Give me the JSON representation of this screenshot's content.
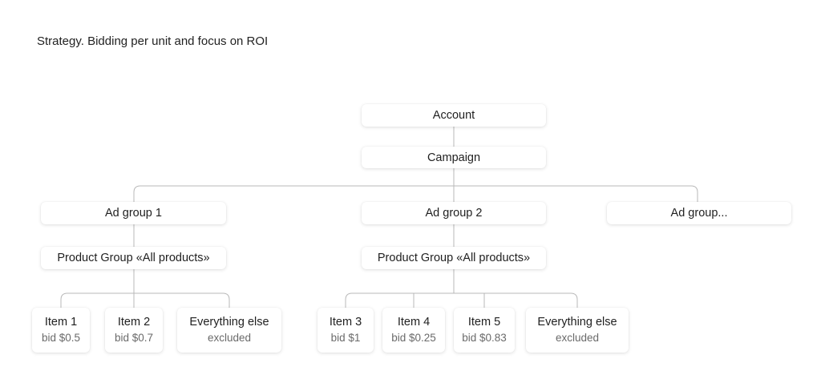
{
  "title": "Strategy. Bidding per unit and focus on ROI",
  "account": "Account",
  "campaign": "Campaign",
  "ad_groups": [
    {
      "label": "Ad group 1",
      "product_group": "Product Group «All products»",
      "items": [
        {
          "name": "Item 1",
          "detail": "bid $0.5"
        },
        {
          "name": "Item 2",
          "detail": "bid $0.7"
        },
        {
          "name": "Everything else",
          "detail": "excluded"
        }
      ]
    },
    {
      "label": "Ad group 2",
      "product_group": "Product Group «All products»",
      "items": [
        {
          "name": "Item 3",
          "detail": "bid $1"
        },
        {
          "name": "Item 4",
          "detail": "bid $0.25"
        },
        {
          "name": "Item 5",
          "detail": "bid $0.83"
        },
        {
          "name": "Everything else",
          "detail": "excluded"
        }
      ]
    },
    {
      "label": "Ad group..."
    }
  ]
}
